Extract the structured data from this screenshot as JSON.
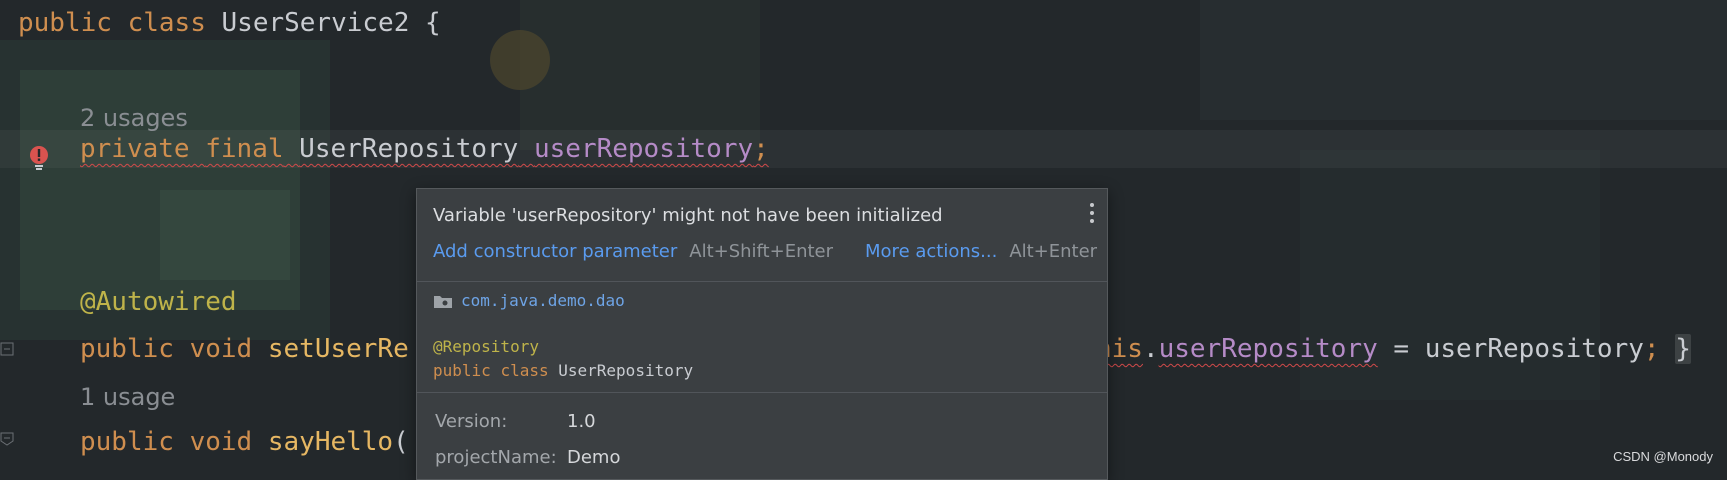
{
  "editor": {
    "line_class": {
      "kw_public": "public",
      "kw_class": "class",
      "name": "UserService2",
      "brace": "{"
    },
    "usage_field": "2 usages",
    "line_field": {
      "kw_private": "private",
      "kw_final": "final",
      "type": "UserRepository",
      "field": "userRepository",
      "semi": ";"
    },
    "line_annotation": "@Autowired",
    "line_setter": {
      "kw_public": "public",
      "kw_void": "void",
      "name": "setUserRe"
    },
    "line_setter_tail": {
      "this_part": "his",
      "dot": ".",
      "field": "userRepository",
      "assign": " = userRepository",
      "semi": ";",
      "close": "}"
    },
    "usage_method": "1 usage",
    "line_sayhello": {
      "kw_public": "public",
      "kw_void": "void",
      "name": "sayHello",
      "paren": "("
    }
  },
  "popup": {
    "message": "Variable 'userRepository' might not have been initialized",
    "action_primary": "Add constructor parameter",
    "action_primary_shortcut": "Alt+Shift+Enter",
    "action_more": "More actions...",
    "action_more_shortcut": "Alt+Enter",
    "package": "com.java.demo.dao",
    "decl_annotation": "@Repository",
    "decl_kw_public": "public",
    "decl_kw_class": "class",
    "decl_name": "UserRepository",
    "meta": [
      {
        "key": "Version:",
        "value": "1.0"
      },
      {
        "key": "projectName:",
        "value": "Demo"
      }
    ]
  },
  "watermark": "CSDN @Monody",
  "colors": {
    "background": "#23282b",
    "keyword": "#cf8e4f",
    "field": "#b58bc7",
    "annotation": "#bfb44a",
    "link": "#5a9bef",
    "error": "#d24a4a"
  }
}
